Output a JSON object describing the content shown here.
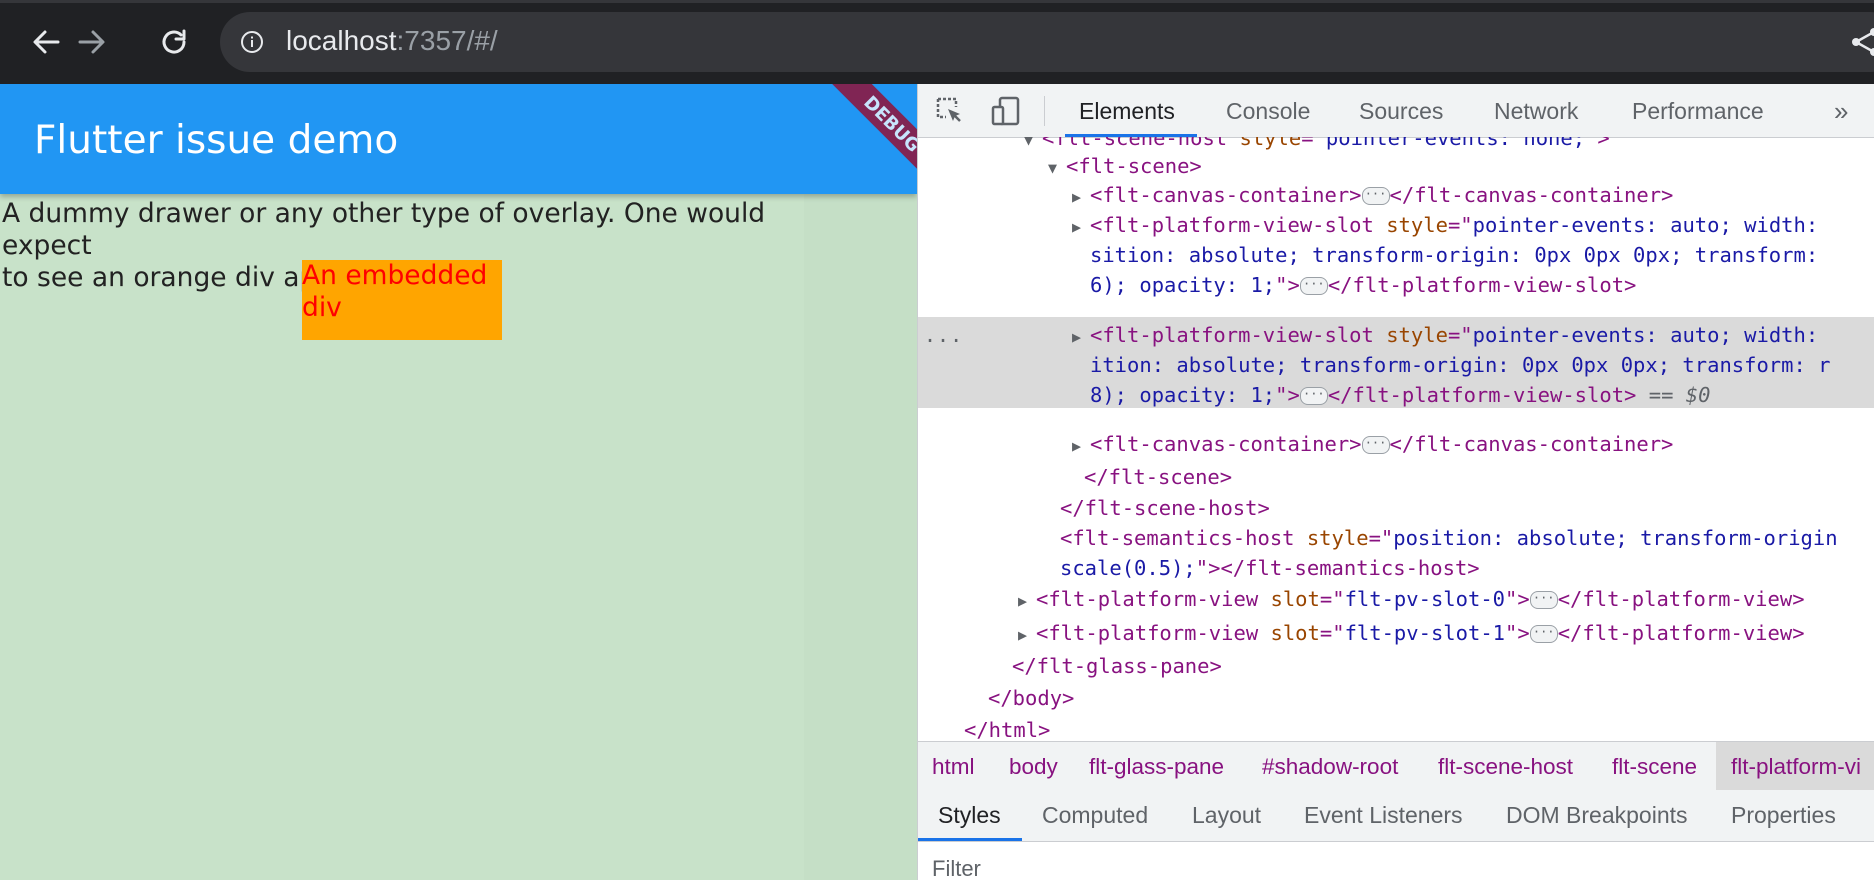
{
  "browser": {
    "url_host": "localhost",
    "url_rest": ":7357/#/"
  },
  "flutter": {
    "appbar_title": "Flutter issue demo",
    "debug_banner": "DEBUG",
    "body_text_line1": "A dummy drawer or any other type of overlay. One would expect",
    "body_text_line2": "to see an orange div appear below.",
    "embedded_line1": "An embedded",
    "embedded_line2": "div",
    "colors": {
      "appbar": "#2196f3",
      "background": "#c8e2c9",
      "embedded_bg": "#ffa500",
      "embedded_text": "#ff0000"
    }
  },
  "devtools": {
    "tabs": [
      "Elements",
      "Console",
      "Sources",
      "Network",
      "Performance"
    ],
    "more": "»",
    "dom": {
      "l0": {
        "tag": "<flt-scene-host ",
        "attr": "style",
        "eq": "=\"",
        "val": "pointer-events: none;",
        "close": "\">"
      },
      "l1": "<flt-scene>",
      "l2": {
        "open": "<flt-canvas-container>",
        "close": "</flt-canvas-container>"
      },
      "l3": {
        "tag": "<flt-platform-view-slot ",
        "attr": "style",
        "eq": "=\"",
        "val": "pointer-events: auto; width:"
      },
      "l3b": "sition: absolute; transform-origin: 0px 0px 0px; transform:",
      "l3c_val": "6); opacity: 1;",
      "l3c_close": "\">",
      "l3c_end": "</flt-platform-view-slot>",
      "l4": {
        "tag": "<flt-platform-view-slot ",
        "attr": "style",
        "eq": "=\"",
        "val": "pointer-events: auto; width:"
      },
      "l4b": "ition: absolute; transform-origin: 0px 0px 0px; transform: r",
      "l4c_val": "8); opacity: 1;",
      "l4c_close": "\">",
      "l4c_end": "</flt-platform-view-slot>",
      "l4c_eq": " == $0",
      "l5": {
        "open": "<flt-canvas-container>",
        "close": "</flt-canvas-container>"
      },
      "l6": "</flt-scene>",
      "l7": "</flt-scene-host>",
      "l8": {
        "tag": "<flt-semantics-host ",
        "attr": "style",
        "eq": "=\"",
        "val": "position: absolute; transform-origin"
      },
      "l8b_val": "scale(0.5);",
      "l8b_close": "\">",
      "l8b_end": "</flt-semantics-host>",
      "l9": {
        "tag": "<flt-platform-view ",
        "attr": "slot",
        "eq": "=\"",
        "val": "flt-pv-slot-0",
        "close": "\">",
        "end": "</flt-platform-view>"
      },
      "l10": {
        "tag": "<flt-platform-view ",
        "attr": "slot",
        "eq": "=\"",
        "val": "flt-pv-slot-1",
        "close": "\">",
        "end": "</flt-platform-view>"
      },
      "l11": "</flt-glass-pane>",
      "l12": "</body>",
      "l13": "</html>",
      "more_dots": "...",
      "ellipsis": "···"
    },
    "breadcrumbs": [
      "html",
      "body",
      "flt-glass-pane",
      "#shadow-root",
      "flt-scene-host",
      "flt-scene",
      "flt-platform-vi"
    ],
    "subtabs": [
      "Styles",
      "Computed",
      "Layout",
      "Event Listeners",
      "DOM Breakpoints",
      "Properties"
    ],
    "filter_placeholder": "Filter"
  }
}
